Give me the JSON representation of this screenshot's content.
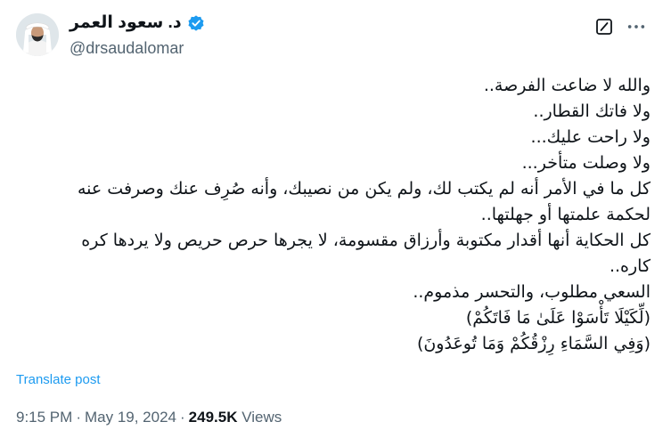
{
  "author": {
    "display_name": "د. سعود العمر",
    "handle": "@drsaudalomar",
    "verified": true
  },
  "icons": {
    "verified": "verified-badge-icon",
    "grok": "grok-icon",
    "more": "more-options-icon"
  },
  "colors": {
    "accent": "#1d9bf0",
    "text": "#0f1419",
    "secondary": "#536471"
  },
  "tweet": {
    "lines": [
      "والله لا ضاعت الفرصة..",
      "ولا فاتك القطار..",
      "ولا راحت عليك...",
      "ولا وصلت متأخر...",
      "كل ما في الأمر أنه لم يكتب لك، ولم يكن من نصيبك، وأنه صُرِف عنك وصرفت عنه",
      "لحكمة علمتها أو جهلتها..",
      "كل الحكاية أنها أقدار مكتوبة وأرزاق مقسومة، لا يجرها حرص حريص ولا يردها كره",
      "كاره..",
      "السعي مطلوب، والتحسر مذموم..",
      "(لِّكَيْلَا تَأْسَوْا عَلَىٰ مَا فَاتَكُمْ)",
      "(وَفِي السَّمَاءِ رِزْقُكُمْ وَمَا تُوعَدُونَ)"
    ]
  },
  "translate_label": "Translate post",
  "meta": {
    "time": "9:15 PM",
    "date": "May 19, 2024",
    "views_count": "249.5K",
    "views_label": "Views"
  }
}
